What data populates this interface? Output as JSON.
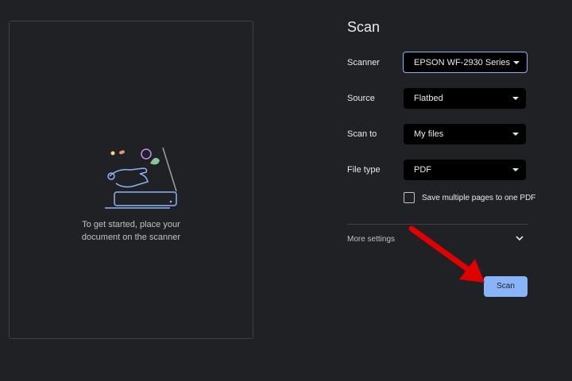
{
  "preview": {
    "message_line1": "To get started, place your",
    "message_line2": "document on the scanner"
  },
  "panel": {
    "title": "Scan",
    "rows": [
      {
        "label": "Scanner",
        "value": "EPSON WF-2930 Series"
      },
      {
        "label": "Source",
        "value": "Flatbed"
      },
      {
        "label": "Scan to",
        "value": "My files"
      },
      {
        "label": "File type",
        "value": "PDF"
      }
    ],
    "checkbox_label": "Save multiple pages to one PDF",
    "more_settings": "More settings",
    "scan_button": "Scan"
  },
  "colors": {
    "background": "#202124",
    "accent": "#8ab4f8",
    "annotation_arrow": "#e00000"
  },
  "icons": [
    "scanner-illustration",
    "chevron-down-icon",
    "dropdown-caret-icon",
    "checkbox-icon"
  ]
}
